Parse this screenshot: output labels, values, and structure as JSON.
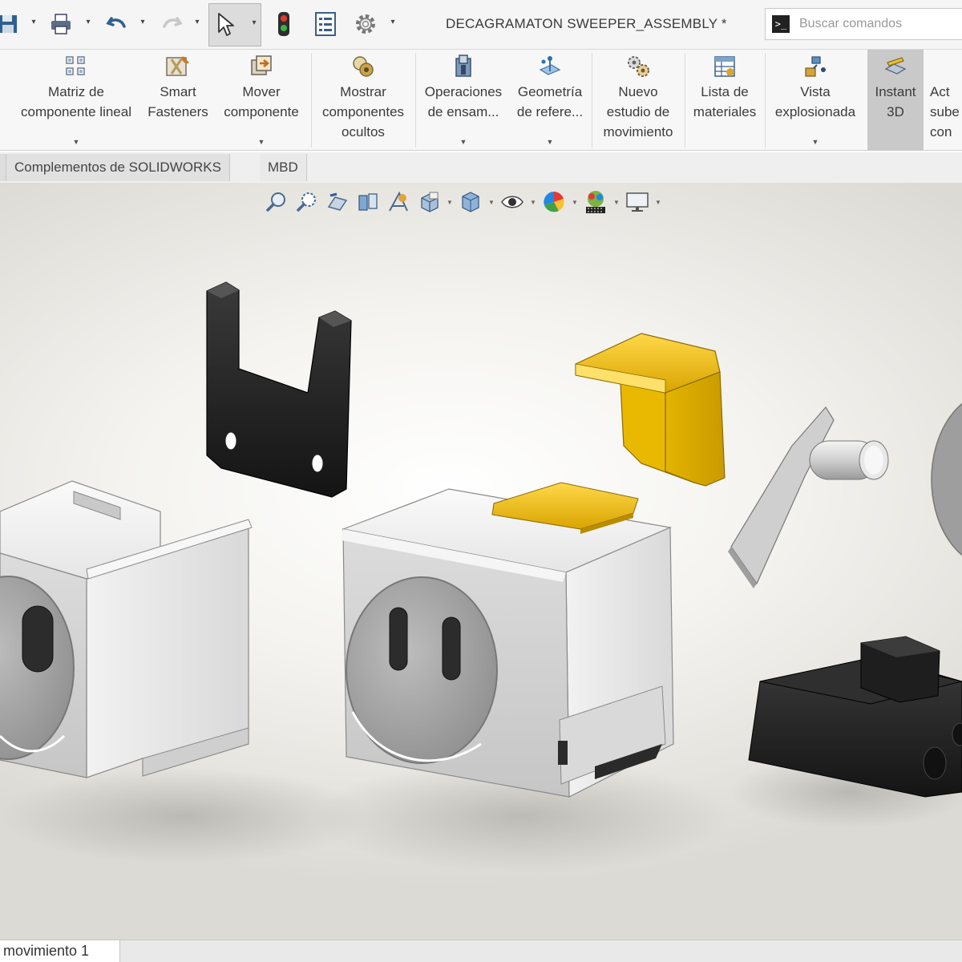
{
  "app": {
    "document_title": "DECAGRAMATON SWEEPER_ASSEMBLY *",
    "search_placeholder": "Buscar comandos",
    "search_prompt_glyph": ">_"
  },
  "quick_access": [
    {
      "name": "save-icon",
      "dropdown": true
    },
    {
      "name": "print-icon",
      "dropdown": true
    },
    {
      "name": "undo-icon",
      "dropdown": true
    },
    {
      "name": "redo-icon",
      "dropdown": true
    },
    {
      "name": "select-icon",
      "dropdown": true
    },
    {
      "name": "traffic-light-icon",
      "dropdown": false
    },
    {
      "name": "file-properties-icon",
      "dropdown": false
    },
    {
      "name": "options-gear-icon",
      "dropdown": true
    }
  ],
  "ribbon": {
    "buttons": [
      {
        "label": "Matriz de\ncomponente lineal",
        "icon": "linear-pattern-icon",
        "dropdown": true
      },
      {
        "label": "Smart\nFasteners",
        "icon": "smart-fasteners-icon",
        "dropdown": false
      },
      {
        "label": "Mover\ncomponente",
        "icon": "move-component-icon",
        "dropdown": true
      },
      {
        "label": "Mostrar\ncomponentes\nocultos",
        "icon": "show-hidden-icon",
        "dropdown": false
      },
      {
        "label": "Operaciones\nde ensam...",
        "icon": "assembly-features-icon",
        "dropdown": true
      },
      {
        "label": "Geometría\nde refere...",
        "icon": "reference-geometry-icon",
        "dropdown": true
      },
      {
        "label": "Nuevo\nestudio de\nmovimiento",
        "icon": "motion-study-icon",
        "dropdown": false
      },
      {
        "label": "Lista de\nmateriales",
        "icon": "bill-of-materials-icon",
        "dropdown": false
      },
      {
        "label": "Vista\nexplosionada",
        "icon": "exploded-view-icon",
        "dropdown": true
      },
      {
        "label": "Instant\n3D",
        "icon": "instant-3d-icon",
        "dropdown": false,
        "active": true
      },
      {
        "label": "Act\nsube\ncon",
        "icon": "",
        "dropdown": false
      }
    ]
  },
  "tabs": {
    "addins": "Complementos de SOLIDWORKS",
    "mbd": "MBD"
  },
  "headsup": [
    "zoom-to-fit-icon",
    "zoom-area-icon",
    "previous-view-icon",
    "section-view-icon",
    "dynamic-annotation-icon",
    "view-orientation-icon",
    "display-style-icon",
    "hide-show-icon",
    "edit-appearance-icon",
    "apply-scene-icon",
    "view-settings-icon"
  ],
  "bottom": {
    "motion_tab": "movimiento 1"
  },
  "colors": {
    "part_gray": "#ececec",
    "part_dark": "#2a2a2a",
    "part_yellow": "#f2c516"
  }
}
